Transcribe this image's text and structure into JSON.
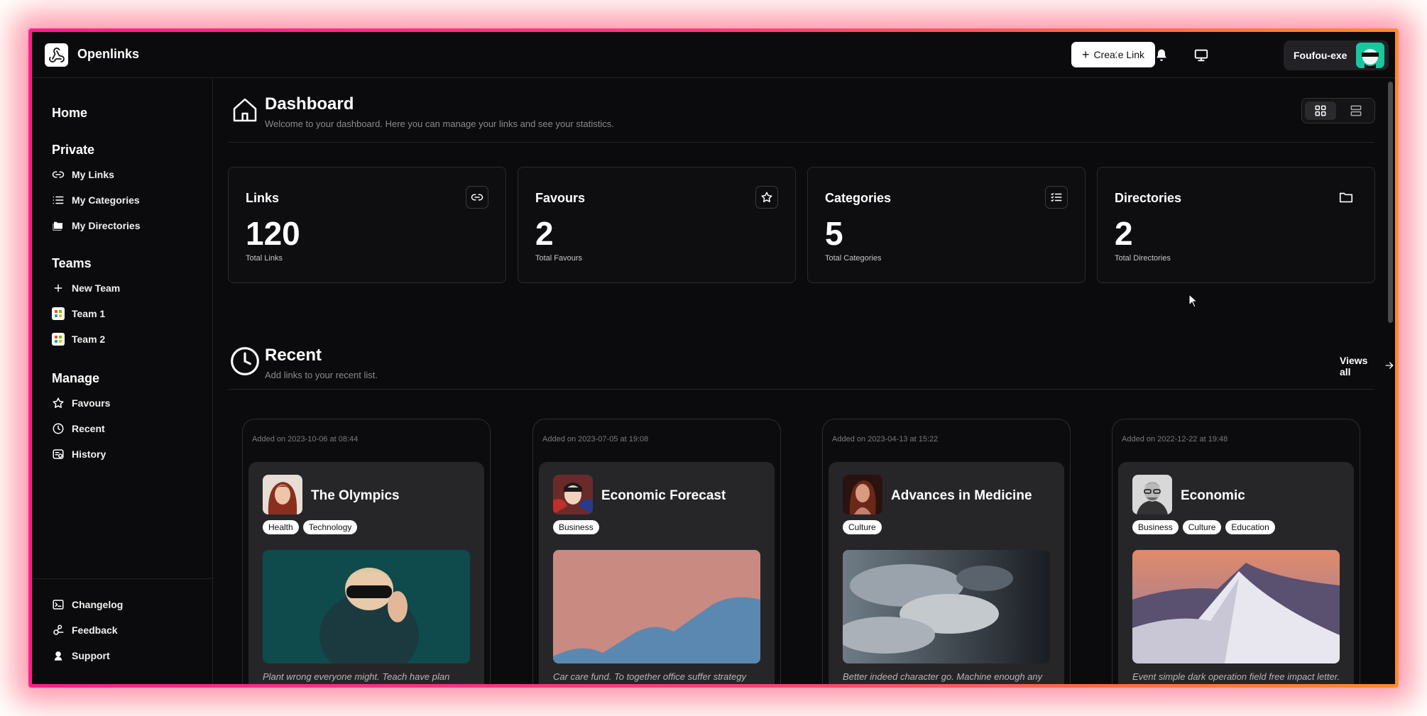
{
  "app": {
    "name": "Openlinks"
  },
  "topbar": {
    "create_label": "Create Link",
    "user_name": "Foufou-exe"
  },
  "sidebar": {
    "home": "Home",
    "private": {
      "heading": "Private",
      "items": [
        {
          "label": "My Links",
          "icon": "link-icon"
        },
        {
          "label": "My Categories",
          "icon": "list-icon"
        },
        {
          "label": "My Directories",
          "icon": "folders-icon"
        }
      ]
    },
    "teams": {
      "heading": "Teams",
      "items": [
        {
          "label": "New Team",
          "icon": "plus-icon"
        },
        {
          "label": "Team 1",
          "icon": "team-logo-icon"
        },
        {
          "label": "Team 2",
          "icon": "team-logo-icon"
        }
      ]
    },
    "manage": {
      "heading": "Manage",
      "items": [
        {
          "label": "Favours",
          "icon": "star-icon"
        },
        {
          "label": "Recent",
          "icon": "clock-icon"
        },
        {
          "label": "History",
          "icon": "history-icon"
        }
      ]
    },
    "footer": [
      {
        "label": "Changelog",
        "icon": "terminal-icon"
      },
      {
        "label": "Feedback",
        "icon": "feedback-icon"
      },
      {
        "label": "Support",
        "icon": "support-icon"
      }
    ]
  },
  "dashboard": {
    "title": "Dashboard",
    "subtitle": "Welcome to your dashboard. Here you can manage your links and see your statistics."
  },
  "stats": [
    {
      "title": "Links",
      "value": "120",
      "label": "Total Links",
      "icon": "link-icon"
    },
    {
      "title": "Favours",
      "value": "2",
      "label": "Total Favours",
      "icon": "star-icon"
    },
    {
      "title": "Categories",
      "value": "5",
      "label": "Total Categories",
      "icon": "list-icon"
    },
    {
      "title": "Directories",
      "value": "2",
      "label": "Total Directories",
      "icon": "folder-icon"
    }
  ],
  "recent": {
    "title": "Recent",
    "subtitle": "Add links to your recent list.",
    "views_all": "Views all"
  },
  "links": [
    {
      "added": "Added on 2023-10-06 at 08:44",
      "title": "The Olympics",
      "tags": [
        "Health",
        "Technology"
      ],
      "desc": "Plant wrong everyone might. Teach have plan reason. Agency perhaps station hit majority baby three. Full town serious interesting centu..."
    },
    {
      "added": "Added on 2023-07-05 at 19:08",
      "title": "Economic Forecast",
      "tags": [
        "Business"
      ],
      "desc": "Car care fund. To together office suffer strategy body big. Soon me only professor."
    },
    {
      "added": "Added on 2023-04-13 at 15:22",
      "title": "Advances in Medicine",
      "tags": [
        "Culture"
      ],
      "desc": "Better indeed character go. Machine enough any next garden local. Movement brother ability form."
    },
    {
      "added": "Added on 2022-12-22 at 19:48",
      "title": "Economic",
      "tags": [
        "Business",
        "Culture",
        "Education"
      ],
      "desc": "Event simple dark operation field free impact letter. In choose city choose citizen person attack."
    }
  ]
}
